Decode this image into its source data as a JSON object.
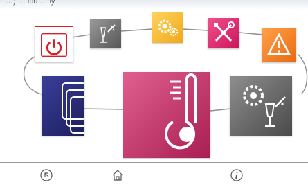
{
  "header": {
    "partial_text": "…) … ipu … ly"
  },
  "menu": {
    "tiles": [
      {
        "id": "power",
        "icon": "power-icon",
        "color": "#d81f2a"
      },
      {
        "id": "cleaning",
        "icon": "cleaning-brush-glass-icon",
        "color": "#7a7a7a"
      },
      {
        "id": "settings",
        "icon": "gears-icon",
        "color": "#f2b82c"
      },
      {
        "id": "service",
        "icon": "wrench-screwdriver-icon",
        "color": "#e2246f"
      },
      {
        "id": "alarms",
        "icon": "warning-icon",
        "color": "#f07a1e"
      },
      {
        "id": "programs",
        "icon": "stacked-pages-icon",
        "color": "#2c2f7d"
      },
      {
        "id": "temperature",
        "icon": "thermometer-icon",
        "color": "#c02b60"
      },
      {
        "id": "wash-settings",
        "icon": "gear-glass-icon",
        "color": "#6b6b6b"
      }
    ]
  },
  "footer": {
    "buttons": [
      {
        "id": "back",
        "icon": "back-arrow-icon"
      },
      {
        "id": "home",
        "icon": "home-icon"
      },
      {
        "id": "info",
        "icon": "info-icon"
      }
    ]
  }
}
